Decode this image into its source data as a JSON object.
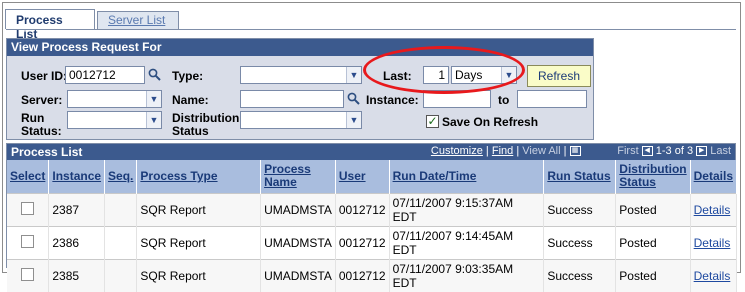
{
  "tabs": [
    {
      "label": "Process List",
      "active": true
    },
    {
      "label": "Server List",
      "active": false
    }
  ],
  "filter": {
    "header": "View Process Request For",
    "user_id_label": "User ID:",
    "user_id_value": "0012712",
    "type_label": "Type:",
    "type_value": "",
    "last_label": "Last:",
    "last_value": "1",
    "last_unit": "Days",
    "refresh_label": "Refresh",
    "server_label": "Server:",
    "server_value": "",
    "name_label": "Name:",
    "name_value": "",
    "instance_label": "Instance:",
    "instance_from": "",
    "to_label": "to",
    "instance_to": "",
    "run_status_label_1": "Run",
    "run_status_label_2": "Status:",
    "run_status_value": "",
    "dist_status_label_1": "Distribution",
    "dist_status_label_2": "Status",
    "dist_status_value": "",
    "save_on_refresh_label": "Save On Refresh",
    "save_on_refresh_checked": true
  },
  "grid": {
    "title": "Process List",
    "customize": "Customize",
    "find": "Find",
    "view_all": "View All",
    "first": "First",
    "range": "1-3 of 3",
    "last": "Last",
    "columns": [
      "Select",
      "Instance",
      "Seq.",
      "Process Type",
      "Process Name",
      "User",
      "Run Date/Time",
      "Run Status",
      "Distribution Status",
      "Details"
    ],
    "rows": [
      {
        "instance": "2387",
        "seq": "",
        "type": "SQR Report",
        "name": "UMADMSTA",
        "user": "0012712",
        "date": "07/11/2007  9:15:37AM EDT",
        "status": "Success",
        "dist": "Posted",
        "details": "Details"
      },
      {
        "instance": "2386",
        "seq": "",
        "type": "SQR Report",
        "name": "UMADMSTA",
        "user": "0012712",
        "date": "07/11/2007  9:14:45AM EDT",
        "status": "Success",
        "dist": "Posted",
        "details": "Details"
      },
      {
        "instance": "2385",
        "seq": "",
        "type": "SQR Report",
        "name": "UMADMSTA",
        "user": "0012712",
        "date": "07/11/2007  9:03:35AM EDT",
        "status": "Success",
        "dist": "Posted",
        "details": "Details"
      }
    ]
  },
  "colors": {
    "header_bg": "#3c5a8e",
    "panel_bg": "#d9dde8",
    "column_header_bg": "#a9bdde",
    "highlight_oval": "#e8191c",
    "refresh_bg": "#fafcc8"
  }
}
